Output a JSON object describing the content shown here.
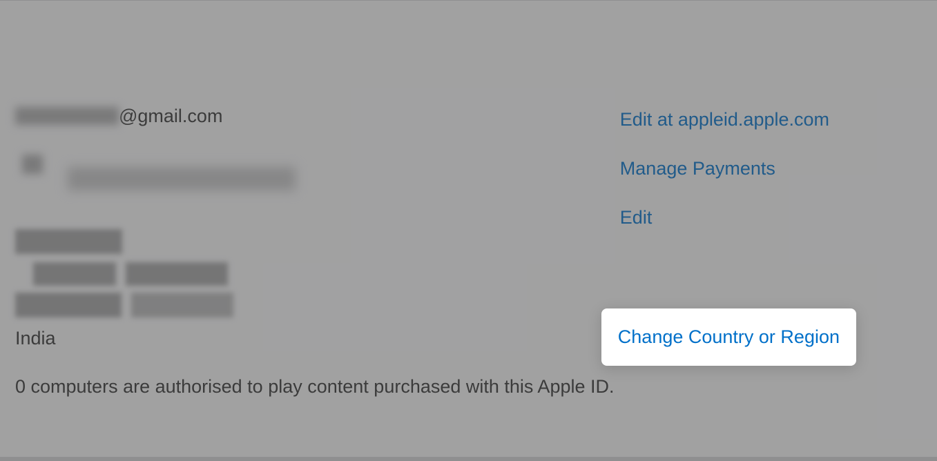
{
  "account": {
    "email_domain": "@gmail.com",
    "country": "India",
    "authorized_text": "0 computers are authorised to play content purchased with this Apple ID."
  },
  "links": {
    "edit_appleid": "Edit at appleid.apple.com",
    "manage_payments": "Manage Payments",
    "edit": "Edit",
    "change_country": "Change Country or Region"
  }
}
